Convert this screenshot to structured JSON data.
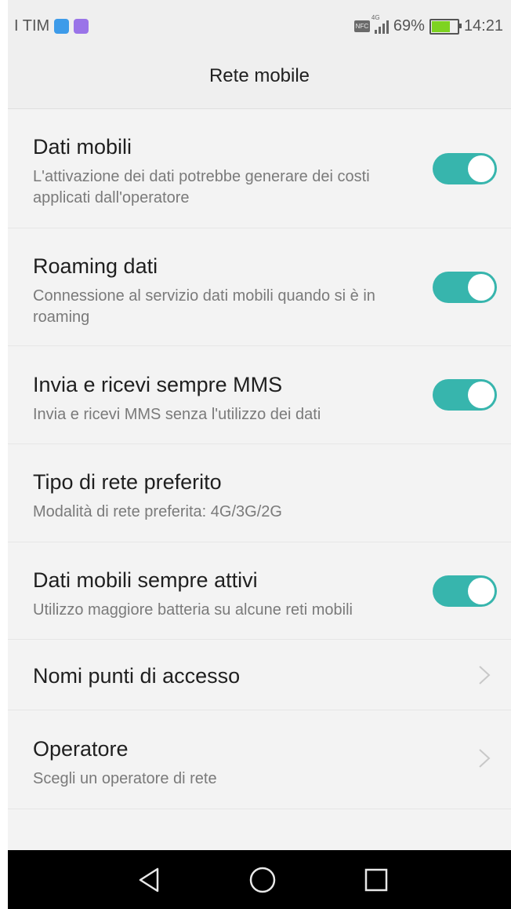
{
  "status_bar": {
    "carrier": "I TIM",
    "network_type": "4G",
    "battery_level": "69%",
    "battery_fraction": 0.69,
    "time": "14:21",
    "icons": [
      "bluetooth-icon",
      "viber-icon",
      "nfc-icon",
      "signal-icon",
      "battery-icon"
    ]
  },
  "header": {
    "title": "Rete mobile"
  },
  "settings": [
    {
      "title": "Dati mobili",
      "subtitle": "L'attivazione dei dati potrebbe generare dei costi applicati dall'operatore",
      "control": "toggle",
      "enabled": true
    },
    {
      "title": "Roaming dati",
      "subtitle": "Connessione al servizio dati mobili quando si è in roaming",
      "control": "toggle",
      "enabled": true
    },
    {
      "title": "Invia e ricevi sempre MMS",
      "subtitle": "Invia e ricevi MMS senza l'utilizzo dei dati",
      "control": "toggle",
      "enabled": true
    },
    {
      "title": "Tipo di rete preferito",
      "subtitle": "Modalità di rete preferita: 4G/3G/2G",
      "control": "none"
    },
    {
      "title": "Dati mobili sempre attivi",
      "subtitle": "Utilizzo maggiore batteria su alcune reti mobili",
      "control": "toggle",
      "enabled": true
    },
    {
      "title": "Nomi punti di accesso",
      "subtitle": "",
      "control": "chevron"
    },
    {
      "title": "Operatore",
      "subtitle": "Scegli un operatore di rete",
      "control": "chevron"
    }
  ],
  "navigation": [
    "back-icon",
    "home-icon",
    "recents-icon"
  ],
  "colors": {
    "accent": "#37b5ad",
    "background": "#f3f3f3",
    "navbar": "#000000"
  }
}
